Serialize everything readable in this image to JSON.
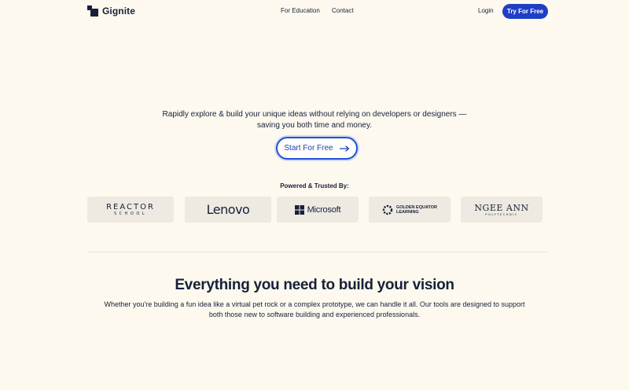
{
  "nav": {
    "brand": "Gignite",
    "links": [
      {
        "label": "For Education"
      },
      {
        "label": "Contact"
      }
    ],
    "login": "Login",
    "cta": "Try For Free"
  },
  "hero": {
    "tagline_line1": "Rapidly explore & build your unique ideas without relying on developers or designers —",
    "tagline_line2": "saving you both time and money.",
    "cta": "Start For Free"
  },
  "trusted": {
    "title": "Powered & Trusted By:",
    "logos": [
      {
        "name": "REACTOR",
        "sub": "SCHOOL"
      },
      {
        "name": "Lenovo"
      },
      {
        "name": "Microsoft"
      },
      {
        "name_line1": "GOLDEN EQUATOR",
        "name_line2": "LEARNING"
      },
      {
        "name": "NGEE ANN",
        "sub": "POLYTECHNIC"
      }
    ]
  },
  "features": {
    "title": "Everything you need to build your vision",
    "subtitle_line1": "Whether you're building a fun idea like a virtual pet rock or a complex prototype, we can handle it all. Our tools are designed to support",
    "subtitle_line2": "both those new to software building and experienced professionals."
  },
  "colors": {
    "background": "#fdf9ee",
    "primary": "#1e3fc4",
    "text": "#16203a",
    "logo_card": "#eeeae1"
  }
}
